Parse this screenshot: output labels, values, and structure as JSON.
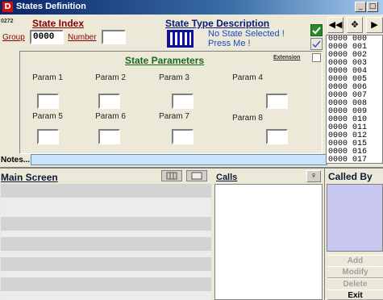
{
  "window": {
    "title": "States Definition",
    "icon_glyph": "D",
    "min_glyph": "_",
    "max_glyph": "□"
  },
  "header": {
    "code": "0272",
    "state_index_label": "State Index",
    "group_label": "Group",
    "group_value": "0000",
    "number_label": "Number",
    "number_value": "",
    "state_type_label": "State Type Description",
    "state_type_message_line1": "No State Selected !",
    "state_type_message_line2": "Press Me !"
  },
  "params": {
    "title": "State Parameters",
    "extension_label": "Extension",
    "labels": [
      "Param 1",
      "Param 2",
      "Param 3",
      "Param 4",
      "Param 5",
      "Param 6",
      "Param 7",
      "Param 8"
    ]
  },
  "notes": {
    "label": "Notes...",
    "value": ""
  },
  "state_list": {
    "items": [
      "0000 000",
      "0000 001",
      "0000 002",
      "0000 003",
      "0000 004",
      "0000 005",
      "0000 006",
      "0000 007",
      "0000 008",
      "0000 009",
      "0000 010",
      "0000 011",
      "0000 012",
      "0000 015",
      "0000 016",
      "0000 017"
    ]
  },
  "nav": {
    "first_glyph": "◀◀",
    "center_glyph": "✥",
    "next_glyph": "▶"
  },
  "main_screen": {
    "title": "Main Screen"
  },
  "calls": {
    "title": "Calls",
    "key_glyph": "♀"
  },
  "called_by": {
    "title": "Called By"
  },
  "actions": {
    "add": "Add",
    "modify": "Modify",
    "delete": "Delete",
    "exit": "Exit"
  },
  "colors": {
    "title_bar": "#0a246a",
    "maroon_label": "#8b0000",
    "navy_label": "#0a1a7a",
    "called_by_panel": "#c8c8f0",
    "notes_field": "#c9e3f8"
  }
}
